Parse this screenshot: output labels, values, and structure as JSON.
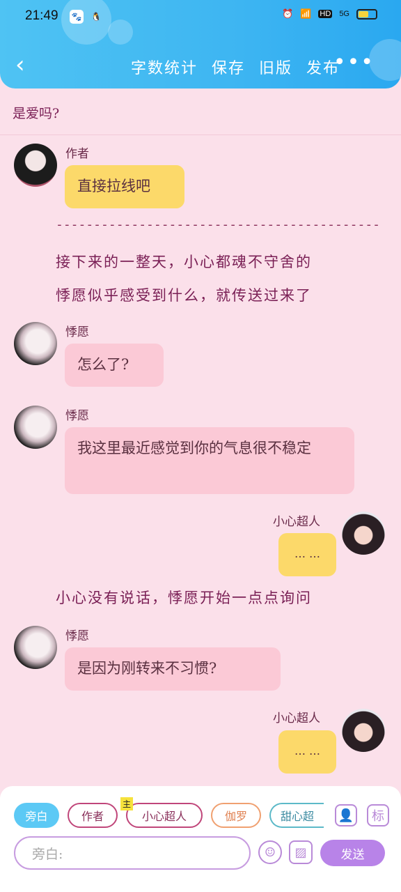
{
  "status": {
    "time": "21:49",
    "hd": "HD",
    "net": "5G"
  },
  "nav": {
    "back_icon": "chevron-left-icon",
    "actions": [
      "字数统计",
      "保存",
      "旧版",
      "发布"
    ],
    "more": "•••"
  },
  "top_line": "是爱吗?",
  "messages": [
    {
      "name": "作者",
      "text": "直接拉线吧"
    },
    {
      "name": "悸愿",
      "text": "怎么了?"
    },
    {
      "name": "悸愿",
      "text": "我这里最近感觉到你的气息很不稳定"
    },
    {
      "name": "小心超人",
      "text": "… …"
    },
    {
      "name": "悸愿",
      "text": "是因为刚转来不习惯?"
    },
    {
      "name": "小心超人",
      "text": "… …"
    }
  ],
  "dashes": "-------------------------------------------",
  "narration": {
    "n1": "接下来的一整天，小心都魂不守舍的",
    "n2": "悸愿似乎感受到什么，就传送过来了",
    "n3": "小心没有说话，悸愿开始一点点询问"
  },
  "chips": {
    "c1": "旁白",
    "c2": "作者",
    "c3": "小心超人",
    "c3_tag": "主",
    "c4": "伽罗",
    "c5": "甜心超"
  },
  "input_placeholder": "旁白:",
  "icons": {
    "mark_label": "标"
  },
  "send_label": "发送",
  "colors": {
    "header": "#3db5f2",
    "background": "#fbe0ea",
    "yellow_bubble": "#fcd96a",
    "pink_bubble": "#fbc9d6",
    "send": "#b883e8"
  }
}
